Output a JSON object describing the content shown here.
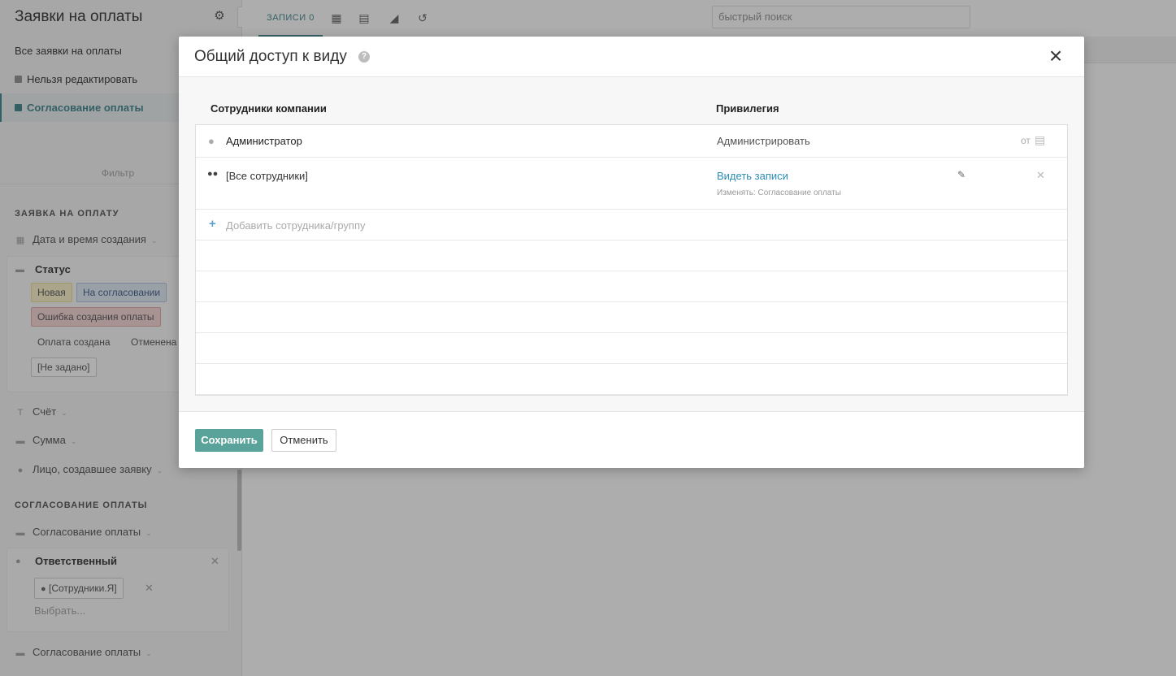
{
  "sidebar": {
    "title": "Заявки на оплаты",
    "views": [
      {
        "label": "Все заявки на оплаты"
      },
      {
        "label": "Нельзя редактировать"
      },
      {
        "label": "Согласование оплаты"
      }
    ],
    "filter_label": "Фильтр",
    "section1_title": "ЗАЯВКА НА ОПЛАТУ",
    "field_created": "Дата и время создания",
    "status_title": "Статус",
    "status_tags": [
      "Новая",
      "На согласовании",
      "Ошибка создания оплаты",
      "Оплата создана",
      "Отменена",
      "[Не задано]"
    ],
    "field_account": "Счёт",
    "field_sum": "Сумма",
    "field_creator": "Лицо, создавшее заявку",
    "section2_title": "СОГЛАСОВАНИЕ ОПЛАТЫ",
    "field_approval": "Согласование оплаты",
    "responsible_title": "Ответственный",
    "responsible_value": "[Сотрудники.Я]",
    "choose_placeholder": "Выбрать...",
    "field_approval2": "Согласование оплаты"
  },
  "topbar": {
    "records_tab": "ЗАПИСИ 0",
    "search_placeholder": "быстрый поиск"
  },
  "modal": {
    "title": "Общий доступ к виду",
    "col_employees": "Сотрудники компании",
    "col_privilege": "Привилегия",
    "rows": [
      {
        "name": "Администратор",
        "privilege": "Администрировать",
        "suffix": "от"
      },
      {
        "name": "[Все сотрудники]",
        "privilege": "Видеть записи",
        "sub": "Изменять: Согласование оплаты"
      }
    ],
    "add_label": "Добавить сотрудника/группу",
    "save_label": "Сохранить",
    "cancel_label": "Отменить"
  },
  "colors": {
    "accent": "#2e7a82",
    "save_button": "#5aa39a",
    "link": "#2a8db6"
  }
}
